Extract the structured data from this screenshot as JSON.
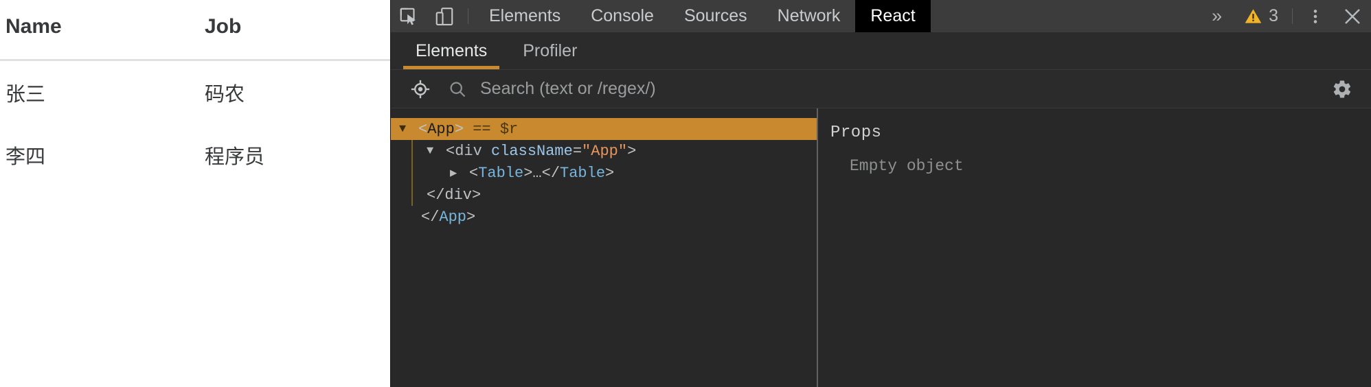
{
  "page": {
    "table": {
      "headers": [
        "Name",
        "Job"
      ],
      "rows": [
        {
          "name": "张三",
          "job": "码农"
        },
        {
          "name": "李四",
          "job": "程序员"
        }
      ]
    }
  },
  "devtools": {
    "toolbar": {
      "inspect_icon": "inspect-element-icon",
      "device_icon": "device-toolbar-icon",
      "tabs": [
        {
          "label": "Elements",
          "selected": false
        },
        {
          "label": "Console",
          "selected": false
        },
        {
          "label": "Sources",
          "selected": false
        },
        {
          "label": "Network",
          "selected": false
        },
        {
          "label": "React",
          "selected": true
        }
      ],
      "more_tabs_label": "»",
      "warning_icon": "warning-triangle-icon",
      "warning_count": "3",
      "kebab_icon": "more-options-icon",
      "close_icon": "close-icon"
    },
    "react_panel": {
      "subtabs": [
        {
          "label": "Elements",
          "active": true
        },
        {
          "label": "Profiler",
          "active": false
        }
      ],
      "search": {
        "placeholder": "Search (text or /regex/)",
        "value": "",
        "select_icon": "select-component-icon",
        "search_icon": "search-icon",
        "settings_icon": "gear-icon"
      },
      "tree": [
        {
          "indent": 0,
          "toggle": "▼",
          "selected": true,
          "tokens": [
            {
              "t": "punct",
              "v": "<"
            },
            {
              "t": "comp",
              "v": "App"
            },
            {
              "t": "punct",
              "v": ">"
            },
            {
              "t": "space",
              "v": " "
            },
            {
              "t": "dollar",
              "v": "== $r"
            }
          ]
        },
        {
          "indent": 1,
          "toggle": "▼",
          "selected": false,
          "tokens": [
            {
              "t": "punct",
              "v": "<"
            },
            {
              "t": "tag",
              "v": "div"
            },
            {
              "t": "space",
              "v": " "
            },
            {
              "t": "attr",
              "v": "className"
            },
            {
              "t": "punct",
              "v": "="
            },
            {
              "t": "str",
              "v": "\"App\""
            },
            {
              "t": "punct",
              "v": ">"
            }
          ]
        },
        {
          "indent": 2,
          "toggle": "▶",
          "selected": false,
          "tokens": [
            {
              "t": "punct",
              "v": "<"
            },
            {
              "t": "comp",
              "v": "Table"
            },
            {
              "t": "punct",
              "v": ">…</"
            },
            {
              "t": "comp",
              "v": "Table"
            },
            {
              "t": "punct",
              "v": ">"
            }
          ]
        },
        {
          "indent": 1,
          "toggle": "",
          "selected": false,
          "tokens": [
            {
              "t": "punct",
              "v": "</div>"
            }
          ]
        },
        {
          "indent": 0,
          "toggle": "",
          "selected": false,
          "tokens": [
            {
              "t": "punct",
              "v": "</"
            },
            {
              "t": "comp",
              "v": "App"
            },
            {
              "t": "punct",
              "v": ">"
            }
          ]
        }
      ],
      "props": {
        "title": "Props",
        "empty_text": "Empty object"
      }
    }
  },
  "colors": {
    "accent_orange": "#c8892f",
    "toolbar_bg": "#3c3c3c",
    "panel_bg": "#282828",
    "subtab_bg": "#2b2b2b",
    "warning_yellow": "#f0b429",
    "component_blue": "#78b5dd",
    "string_orange": "#e8965b"
  }
}
